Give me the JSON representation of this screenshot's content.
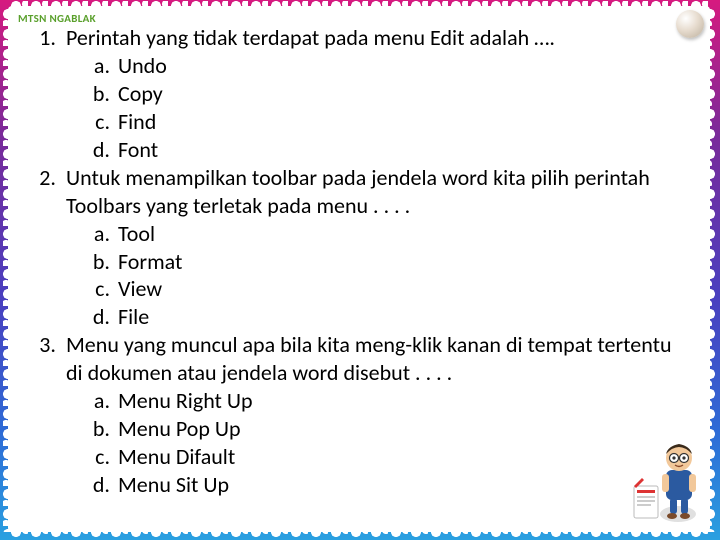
{
  "header": {
    "label": "MTSN NGABLAK"
  },
  "questions": [
    {
      "num": "1.",
      "text": "Perintah yang tidak terdapat pada menu Edit adalah ….",
      "options": [
        {
          "letter": "a.",
          "text": "Undo"
        },
        {
          "letter": "b.",
          "text": "Copy"
        },
        {
          "letter": "c.",
          "text": "Find"
        },
        {
          "letter": "d.",
          "text": "Font"
        }
      ]
    },
    {
      "num": "2.",
      "text": "Untuk menampilkan toolbar pada jendela word kita pilih perintah Toolbars yang terletak pada menu . . . .",
      "options": [
        {
          "letter": "a.",
          "text": "Tool"
        },
        {
          "letter": "b.",
          "text": "Format"
        },
        {
          "letter": "c.",
          "text": "View"
        },
        {
          "letter": "d.",
          "text": "File"
        }
      ]
    },
    {
      "num": "3.",
      "text": "Menu yang muncul apa bila kita meng-klik kanan di tempat tertentu di dokumen atau jendela word disebut . . . .",
      "options": [
        {
          "letter": "a.",
          "text": "Menu Right Up"
        },
        {
          "letter": "b.",
          "text": "Menu Pop Up"
        },
        {
          "letter": "c.",
          "text": "Menu Difault"
        },
        {
          "letter": "d.",
          "text": "Menu Sit Up"
        }
      ]
    }
  ]
}
